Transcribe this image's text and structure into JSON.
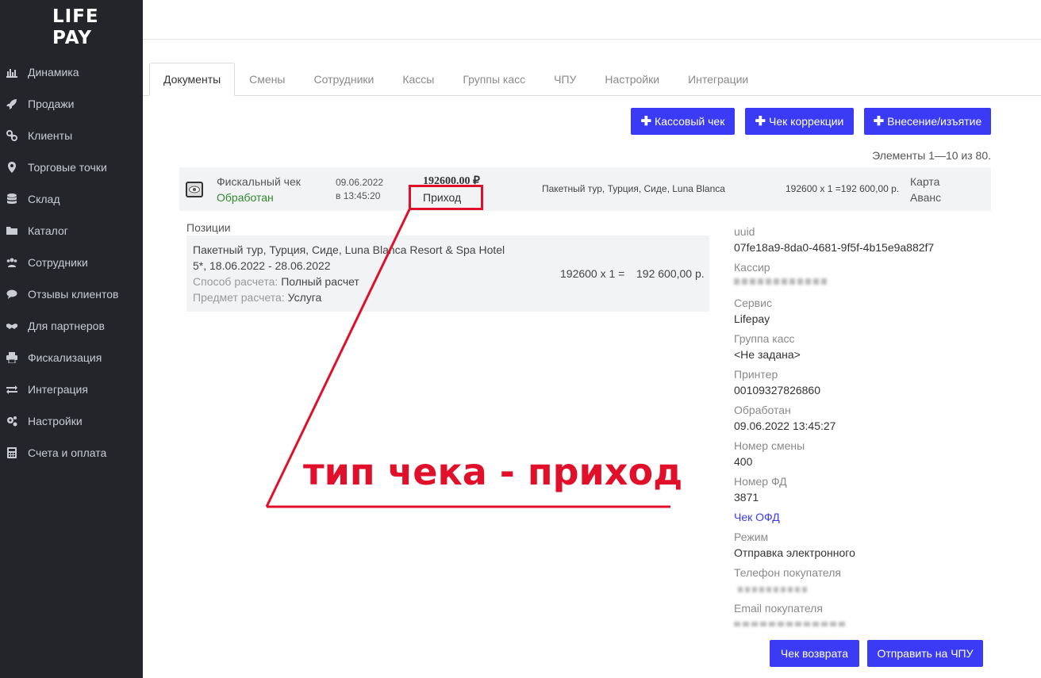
{
  "logo": {
    "line1": "LIFE",
    "line2": "PAY"
  },
  "sidebar": {
    "items": [
      {
        "label": "Динамика",
        "icon": "bar-chart-icon"
      },
      {
        "label": "Продажи",
        "icon": "rocket-icon"
      },
      {
        "label": "Клиенты",
        "icon": "link-icon"
      },
      {
        "label": "Торговые точки",
        "icon": "map-marker-icon"
      },
      {
        "label": "Склад",
        "icon": "database-icon"
      },
      {
        "label": "Каталог",
        "icon": "folder-icon"
      },
      {
        "label": "Сотрудники",
        "icon": "users-icon"
      },
      {
        "label": "Отзывы клиентов",
        "icon": "comments-icon"
      },
      {
        "label": "Для партнеров",
        "icon": "handshake-icon"
      },
      {
        "label": "Фискализация",
        "icon": "printer-icon"
      },
      {
        "label": "Интеграция",
        "icon": "exchange-icon"
      },
      {
        "label": "Настройки",
        "icon": "gears-icon"
      },
      {
        "label": "Счета и оплата",
        "icon": "calculator-icon"
      }
    ]
  },
  "tabs": [
    "Документы",
    "Смены",
    "Сотрудники",
    "Кассы",
    "Группы касс",
    "ЧПУ",
    "Настройки",
    "Интеграции"
  ],
  "buttons": {
    "cash_receipt": "Кассовый чек",
    "correction_receipt": "Чек коррекции",
    "deposit_withdrawal": "Внесение/изъятие",
    "return_receipt": "Чек возврата",
    "send_cpu": "Отправить на ЧПУ"
  },
  "elements_count": "Элементы 1—10 из 80.",
  "document": {
    "type": "Фискальный чек",
    "status": "Обработан",
    "date": "09.06.2022",
    "time": "в 13:45:20",
    "amount": "192600.00 ₽",
    "operation": "Приход",
    "description": "Пакетный тур, Турция, Сиде, Luna Blanca",
    "calc": "192600 x 1 =192 600,00 р.",
    "payment1": "Карта",
    "payment2": "Аванс"
  },
  "positions": {
    "header": "Позиции",
    "name_line1": "Пакетный тур, Турция, Сиде, Luna Blanca Resort & Spa Hotel",
    "name_line2": "5*, 18.06.2022 - 28.06.2022",
    "method_label": "Способ расчета:",
    "method_value": "Полный расчет",
    "subject_label": "Предмет расчета:",
    "subject_value": "Услуга",
    "qty": "192600 x 1 =",
    "total": "192 600,00 р."
  },
  "meta": {
    "uuid_label": "uuid",
    "uuid": "07fe18a9-8da0-4681-9f5f-4b15e9a882f7",
    "cashier_label": "Кассир",
    "service_label": "Сервис",
    "service": "Lifepay",
    "group_label": "Группа касс",
    "group": "<Не задана>",
    "printer_label": "Принтер",
    "printer": "00109327826860",
    "processed_label": "Обработан",
    "processed": "09.06.2022 13:45:27",
    "shift_label": "Номер смены",
    "shift": "400",
    "fd_label": "Номер ФД",
    "fd": "3871",
    "ofd_link": "Чек ОФД",
    "mode_label": "Режим",
    "mode": "Отправка электронного",
    "phone_label": "Телефон покупателя",
    "email_label": "Email покупателя"
  },
  "annotation": "тип чека - приход",
  "colors": {
    "accent": "#3b3bf5",
    "sidebar": "#23252b",
    "status_green": "#2e8b2e",
    "annotation_red": "#e0102a",
    "link": "#3b3bf5"
  }
}
